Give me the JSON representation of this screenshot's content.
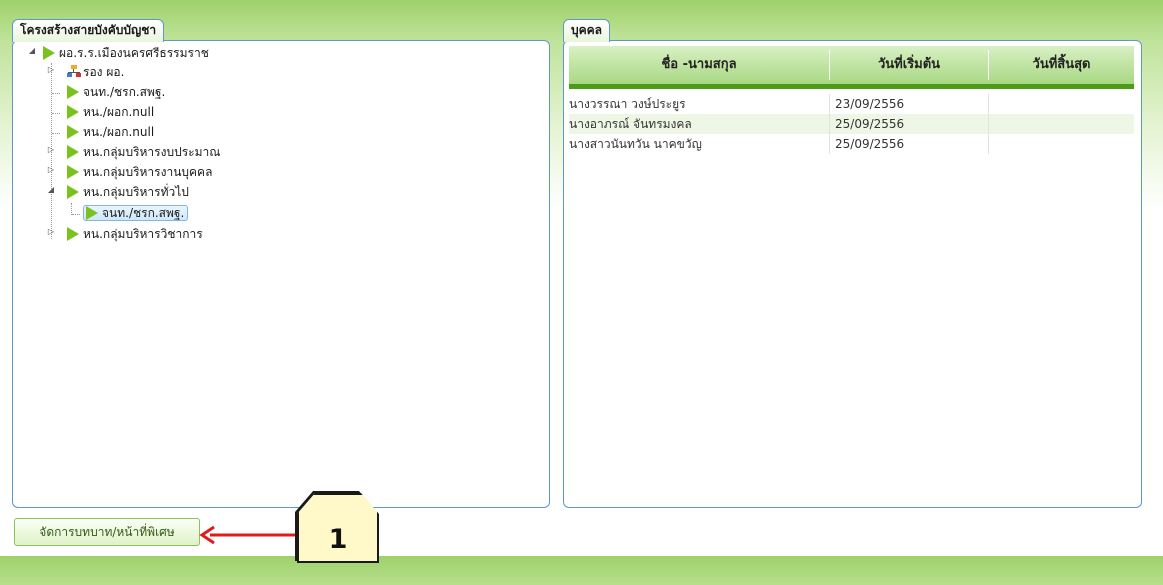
{
  "left_panel": {
    "tab_label": "โครงสร้างสายบังคับบัญชา",
    "tree": {
      "root": "ผอ.ร.ร.เมืองนครศรีธรรมราช",
      "children": [
        "รอง ผอ.",
        "จนท./ชรก.สพฐ.",
        "หน./ผอก.null",
        "หน./ผอก.null",
        "หน.กลุ่มบริหารงบประมาณ",
        "หน.กลุ่มบริหารงานบุคคล",
        "หน.กลุ่มบริหารทั่วไป",
        "หน.กลุ่มบริหารวิชาการ"
      ],
      "selected_child": "จนท./ชรก.สพฐ."
    }
  },
  "right_panel": {
    "tab_label": "บุคคล",
    "columns": [
      "ชื่อ -นามสกุล",
      "วันที่เริ่มต้น",
      "วันที่สิ้นสุด"
    ],
    "rows": [
      {
        "name": "นางวรรณา วงษ์ประยูร",
        "start": "23/09/2556",
        "end": ""
      },
      {
        "name": "นางอาภรณ์ จันทรมงคล",
        "start": "25/09/2556",
        "end": ""
      },
      {
        "name": "นางสาวนันทวัน นาคขวัญ",
        "start": "25/09/2556",
        "end": ""
      }
    ]
  },
  "footer": {
    "manage_button": "จัดการบทบาท/หน้าที่พิเศษ"
  },
  "callout": {
    "number": "1"
  },
  "colors": {
    "tree_arrow": "#7ac21e",
    "header_green": "#a8d883",
    "header_underline": "#4c9c1a",
    "panel_border": "#5f97c9",
    "callout_arrow": "#e01b1b"
  }
}
